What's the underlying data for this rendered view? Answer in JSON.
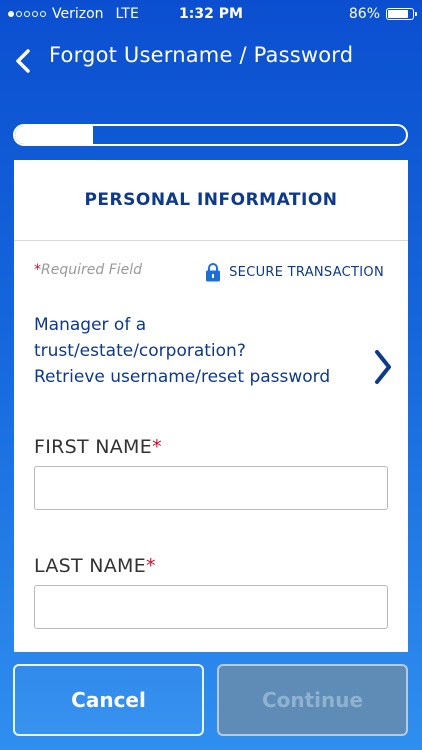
{
  "status_bar": {
    "carrier": "Verizon",
    "network": "LTE",
    "time": "1:32 PM",
    "battery_percent_text": "86%",
    "battery_level": 0.86,
    "signal_bars_filled": 1,
    "signal_bars_total": 5
  },
  "nav": {
    "title": "Forgot Username / Password",
    "back_icon": "chevron-left-icon"
  },
  "progress": {
    "fraction": 0.2
  },
  "card": {
    "title": "PERSONAL INFORMATION",
    "required_star": "*",
    "required_text": "Required Field",
    "secure_text": "SECURE TRANSACTION",
    "secure_icon": "lock-icon",
    "link_lines": [
      "Manager of a",
      "trust/estate/corporation?",
      "Retrieve username/reset password"
    ],
    "link_icon": "chevron-right-icon",
    "first_name": {
      "label": "FIRST NAME",
      "star": "*",
      "value": ""
    },
    "last_name": {
      "label": "LAST NAME",
      "star": "*",
      "value": ""
    }
  },
  "buttons": {
    "cancel_label": "Cancel",
    "continue_label": "Continue"
  },
  "colors": {
    "brand_blue": "#0d3a8a",
    "background_top": "#0b4fd0",
    "background_bottom": "#2f8ff0",
    "required_red": "#c8102e",
    "continue_disabled": "#5f8cb6"
  }
}
